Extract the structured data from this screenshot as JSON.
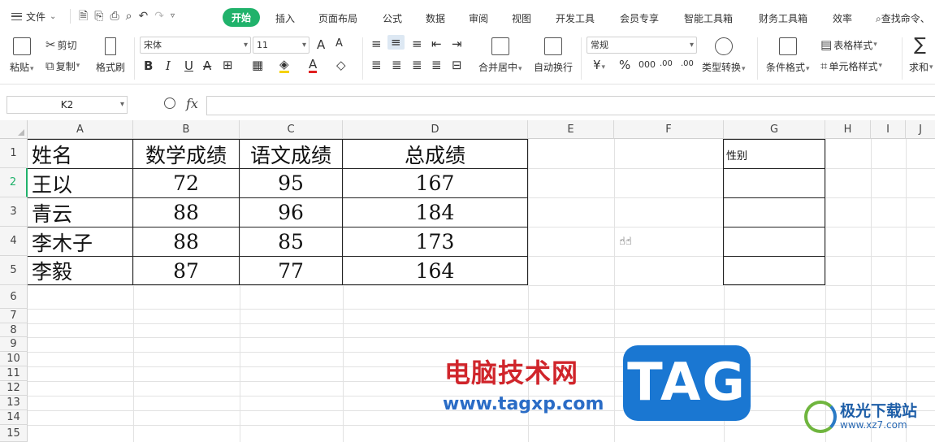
{
  "menu": {
    "file": "文件",
    "tabs": [
      "开始",
      "插入",
      "页面布局",
      "公式",
      "数据",
      "审阅",
      "视图",
      "开发工具",
      "会员专享",
      "智能工具箱",
      "财务工具箱",
      "效率"
    ],
    "search": "查找命令、"
  },
  "ribbon": {
    "paste": "粘贴",
    "cut": "剪切",
    "copy": "复制",
    "format_painter": "格式刷",
    "font_name": "宋体",
    "font_size": "11",
    "merge_center": "合并居中",
    "wrap_text": "自动换行",
    "number_format": "常规",
    "type_convert": "类型转换",
    "conditional_format": "条件格式",
    "table_style": "表格样式",
    "cell_style": "单元格样式",
    "sum": "求和",
    "bold": "B",
    "italic": "I",
    "underline": "U",
    "strike": "A",
    "font_color": "A",
    "increase_font": "A",
    "decrease_font": "A",
    "currency": "¥",
    "percent": "%",
    "thousands": "000",
    "inc_decimal": ".00",
    "dec_decimal": ".00",
    "sigma": "∑"
  },
  "formula_bar": {
    "name_box": "K2",
    "fx": "fx",
    "value": ""
  },
  "grid": {
    "columns": [
      "A",
      "B",
      "C",
      "D",
      "E",
      "F",
      "G",
      "H",
      "I",
      "J"
    ],
    "rows": [
      "1",
      "2",
      "3",
      "4",
      "5",
      "6",
      "7",
      "8",
      "9",
      "10",
      "11",
      "12",
      "13",
      "14",
      "15"
    ],
    "header": [
      "姓名",
      "数学成绩",
      "语文成绩",
      "总成绩"
    ],
    "data": [
      [
        "王以",
        "72",
        "95",
        "167"
      ],
      [
        "青云",
        "88",
        "96",
        "184"
      ],
      [
        "李木子",
        "88",
        "85",
        "173"
      ],
      [
        "李毅",
        "87",
        "77",
        "164"
      ]
    ],
    "g1": "性别"
  },
  "watermark": {
    "brand": "电脑技术网",
    "url": "www.tagxp.com",
    "tag": "TAG",
    "site_name": "极光下载站",
    "site_url": "www.xz7.com"
  }
}
